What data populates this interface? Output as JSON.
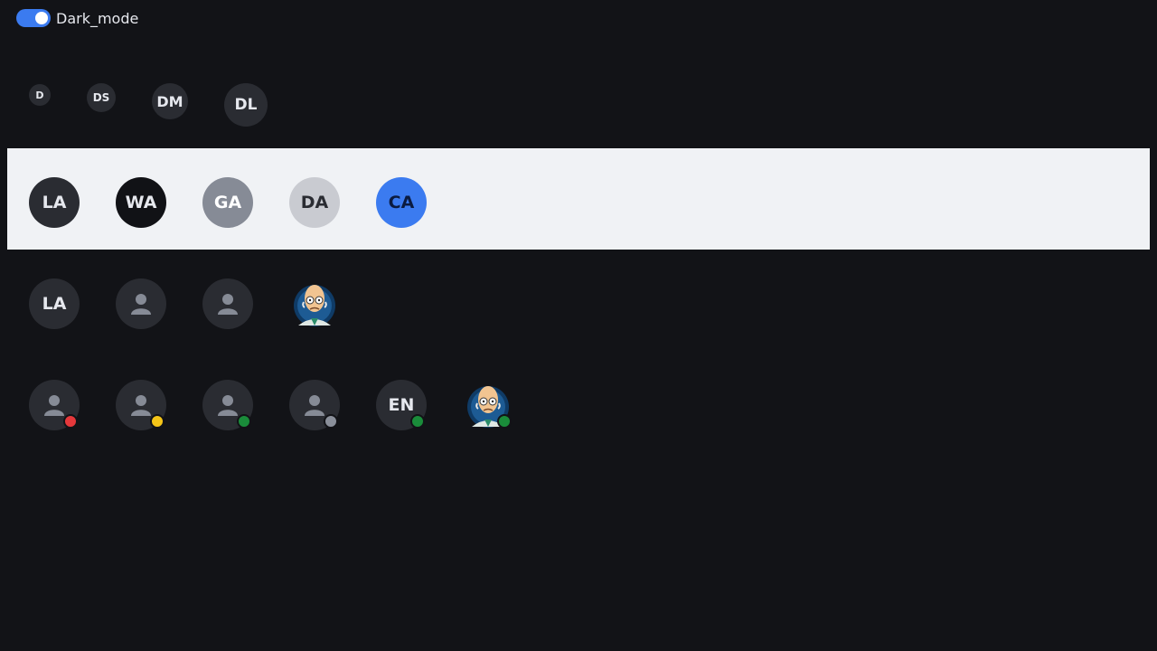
{
  "toggle": {
    "label": "Dark_mode",
    "on": true
  },
  "sizes_row": [
    "D",
    "DS",
    "DM",
    "DL"
  ],
  "color_row": [
    {
      "text": "LA",
      "bg": "#2a2c32",
      "fg": "#e6e8ee"
    },
    {
      "text": "WA",
      "bg": "#111216",
      "fg": "#e6e8ee"
    },
    {
      "text": "GA",
      "bg": "#868b96",
      "fg": "#ffffff"
    },
    {
      "text": "DA",
      "bg": "#c9cbd1",
      "fg": "#2a2c32"
    },
    {
      "text": "CA",
      "bg": "#3b7bf0",
      "fg": "#0b1b40"
    }
  ],
  "type_row": [
    {
      "kind": "initials",
      "text": "LA"
    },
    {
      "kind": "person-icon"
    },
    {
      "kind": "person-icon"
    },
    {
      "kind": "image"
    }
  ],
  "status_row": [
    {
      "kind": "person-icon",
      "status_color": "#e5383b"
    },
    {
      "kind": "person-icon",
      "status_color": "#f5c518"
    },
    {
      "kind": "person-icon",
      "status_color": "#1a8c3a"
    },
    {
      "kind": "person-icon",
      "status_color": "#8a8f9a"
    },
    {
      "kind": "initials",
      "text": "EN",
      "status_color": "#1a8c3a"
    },
    {
      "kind": "image",
      "status_color": "#1a8c3a"
    }
  ]
}
